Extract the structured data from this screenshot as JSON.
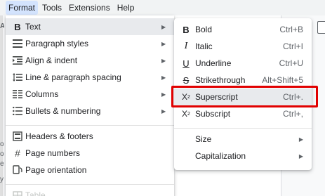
{
  "menubar": {
    "items": [
      "Format",
      "Tools",
      "Extensions",
      "Help"
    ]
  },
  "format_menu": {
    "items": [
      {
        "label": "Text",
        "icon": "bold-icon",
        "submenu": true
      },
      {
        "label": "Paragraph styles",
        "icon": "paragraph-styles-icon",
        "submenu": true
      },
      {
        "label": "Align & indent",
        "icon": "align-indent-icon",
        "submenu": true
      },
      {
        "label": "Line & paragraph spacing",
        "icon": "line-spacing-icon",
        "submenu": true
      },
      {
        "label": "Columns",
        "icon": "columns-icon",
        "submenu": true
      },
      {
        "label": "Bullets & numbering",
        "icon": "bullets-icon",
        "submenu": true
      },
      {
        "label": "Headers & footers",
        "icon": "headers-footers-icon"
      },
      {
        "label": "Page numbers",
        "icon": "hash-icon"
      },
      {
        "label": "Page orientation",
        "icon": "page-orientation-icon"
      },
      {
        "label": "Table",
        "icon": "table-icon",
        "disabled": true
      }
    ]
  },
  "text_submenu": {
    "items": [
      {
        "label": "Bold",
        "shortcut": "Ctrl+B",
        "icon": "bold-icon"
      },
      {
        "label": "Italic",
        "shortcut": "Ctrl+I",
        "icon": "italic-icon"
      },
      {
        "label": "Underline",
        "shortcut": "Ctrl+U",
        "icon": "underline-icon"
      },
      {
        "label": "Strikethrough",
        "shortcut": "Alt+Shift+5",
        "icon": "strikethrough-icon"
      },
      {
        "label": "Superscript",
        "shortcut": "Ctrl+.",
        "icon": "superscript-icon"
      },
      {
        "label": "Subscript",
        "shortcut": "Ctrl+,",
        "icon": "subscript-icon"
      },
      {
        "label": "Size",
        "submenu": true
      },
      {
        "label": "Capitalization",
        "submenu": true
      }
    ]
  },
  "doc_left_chars": [
    "A",
    "o",
    "o",
    "e",
    "y"
  ],
  "colors": {
    "menubar_bg": "#f1f3f4",
    "active_menu_bg": "#d3e3fd",
    "hover_bg": "#e8eaed",
    "highlight_border": "#e10000"
  }
}
